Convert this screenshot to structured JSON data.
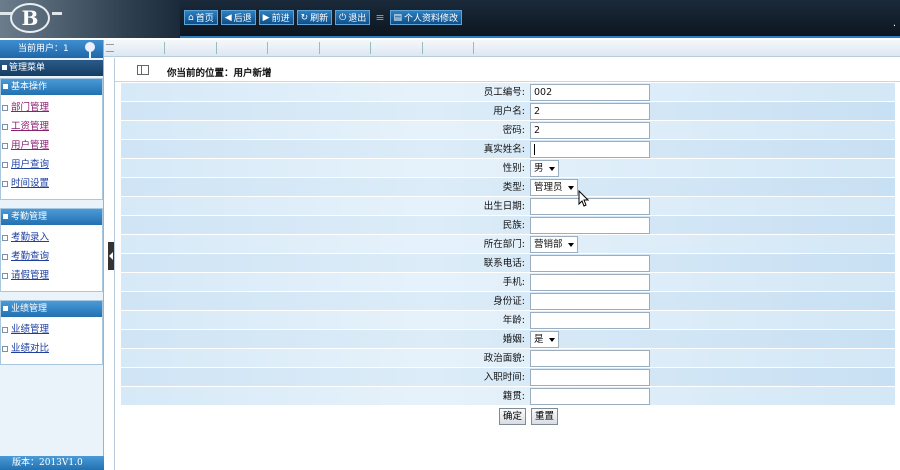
{
  "topbar": {
    "logo_text": "B",
    "buttons": [
      {
        "label": "首页",
        "icon": "home-icon",
        "glyph": "⌂"
      },
      {
        "label": "后退",
        "icon": "back-arrow-icon",
        "glyph": "◀"
      },
      {
        "label": "前进",
        "icon": "forward-arrow-icon",
        "glyph": "▶"
      },
      {
        "label": "刷新",
        "icon": "refresh-icon",
        "glyph": "↻"
      },
      {
        "label": "退出",
        "icon": "power-icon",
        "glyph": "⏻"
      }
    ],
    "separator": "≡",
    "profile_button": {
      "label": "个人资料修改",
      "icon": "profile-icon",
      "glyph": "▤"
    },
    "corner_mark": "."
  },
  "sidebar": {
    "current_user": "当前用户：1",
    "menu_title": "管理菜单",
    "groups": [
      {
        "title": "基本操作",
        "items": [
          "部门管理",
          "工资管理",
          "用户管理",
          "用户查询",
          "时间设置"
        ]
      },
      {
        "title": "考勤管理",
        "items": [
          "考勤录入",
          "考勤查询",
          "请假管理"
        ]
      },
      {
        "title": "业绩管理",
        "items": [
          "业绩管理",
          "业绩对比"
        ]
      }
    ],
    "version": "版本：2013V1.0"
  },
  "location": {
    "text": "你当前的位置：用户新增"
  },
  "form": {
    "rows": [
      {
        "label": "员工编号:",
        "type": "text",
        "value": "002"
      },
      {
        "label": "用户名:",
        "type": "text",
        "value": "2"
      },
      {
        "label": "密码:",
        "type": "text",
        "value": "2"
      },
      {
        "label": "真实姓名:",
        "type": "text",
        "value": "",
        "focused": true
      },
      {
        "label": "性别:",
        "type": "select",
        "value": "男"
      },
      {
        "label": "类型:",
        "type": "select",
        "value": "管理员"
      },
      {
        "label": "出生日期:",
        "type": "text",
        "value": ""
      },
      {
        "label": "民族:",
        "type": "text",
        "value": ""
      },
      {
        "label": "所在部门:",
        "type": "select",
        "value": "营销部"
      },
      {
        "label": "联系电话:",
        "type": "text",
        "value": ""
      },
      {
        "label": "手机:",
        "type": "text",
        "value": ""
      },
      {
        "label": "身份证:",
        "type": "text",
        "value": ""
      },
      {
        "label": "年龄:",
        "type": "text",
        "value": ""
      },
      {
        "label": "婚姻:",
        "type": "select",
        "value": "是"
      },
      {
        "label": "政治面貌:",
        "type": "text",
        "value": ""
      },
      {
        "label": "入职时间:",
        "type": "text",
        "value": ""
      },
      {
        "label": "籍贯:",
        "type": "text",
        "value": ""
      }
    ],
    "submit_label": "确定",
    "reset_label": "重置"
  }
}
